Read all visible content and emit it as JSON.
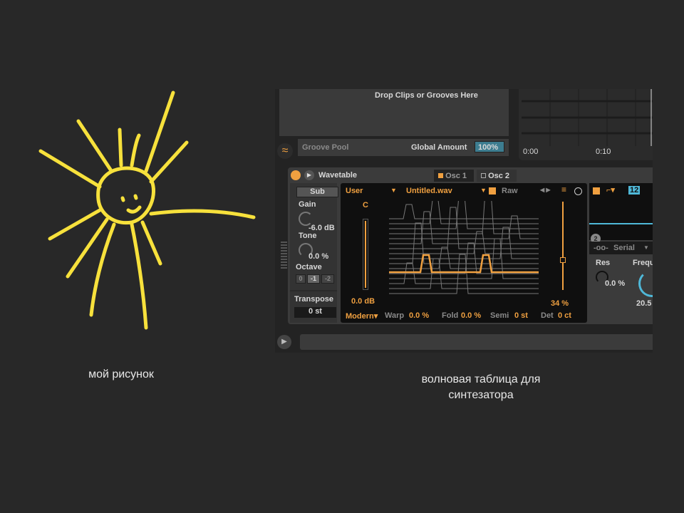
{
  "drawing": {
    "caption": "мой рисунок",
    "stroke_color": "#f7e13c"
  },
  "screenshot_caption": "волновая таблица для синтезатора",
  "groove": {
    "drop_text": "Drop Clips or Grooves Here",
    "pool_label": "Groove Pool",
    "global_amount_label": "Global Amount",
    "global_amount_value": "100%"
  },
  "timeline": {
    "ticks": [
      "0:00",
      "0:10"
    ]
  },
  "device": {
    "title": "Wavetable",
    "tabs": [
      {
        "label": "Osc 1",
        "active": true
      },
      {
        "label": "Osc 2",
        "active": false
      }
    ],
    "sub": {
      "label": "Sub",
      "gain_label": "Gain",
      "gain_value": "-6.0 dB",
      "tone_label": "Tone",
      "tone_value": "0.0 %",
      "octave_label": "Octave",
      "octave_options": [
        "0",
        "-1",
        "-2"
      ],
      "octave_selected": "-1",
      "transpose_label": "Transpose",
      "transpose_value": "0 st"
    },
    "osc": {
      "category": "User",
      "wavetable": "Untitled.wav",
      "raw_label": "Raw",
      "pitch_note": "C",
      "gain_value": "0.0 dB",
      "position_value": "34 %",
      "position_fraction": 0.34,
      "mode": "Modern",
      "warp_label": "Warp",
      "warp_value": "0.0 %",
      "fold_label": "Fold",
      "fold_value": "0.0 %",
      "semi_label": "Semi",
      "semi_value": "0 st",
      "det_label": "Det",
      "det_value": "0 ct"
    },
    "filter": {
      "slope": "12",
      "routing_badge": "2",
      "routing": "Serial",
      "res_label": "Res",
      "res_value": "0.0 %",
      "freq_label": "Frequ",
      "freq_value": "20.5"
    },
    "accent": "#f0a040",
    "cyan": "#4fb8d8"
  }
}
